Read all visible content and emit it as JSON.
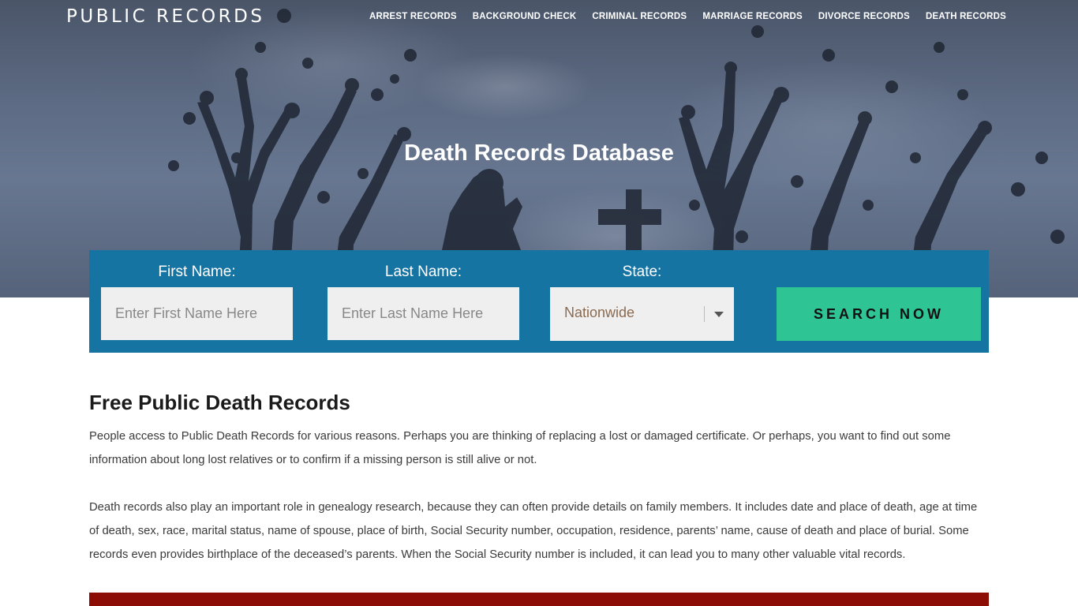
{
  "brand": {
    "name": "PUBLIC RECORDS"
  },
  "nav": {
    "items": [
      "ARREST RECORDS",
      "BACKGROUND CHECK",
      "CRIMINAL RECORDS",
      "MARRIAGE RECORDS",
      "DIVORCE RECORDS",
      "DEATH RECORDS"
    ]
  },
  "hero": {
    "title": "Death Records Database"
  },
  "search": {
    "first_name_label": "First Name:",
    "first_name_placeholder": "Enter First Name Here",
    "last_name_label": "Last Name:",
    "last_name_placeholder": "Enter Last Name Here",
    "state_label": "State:",
    "state_value": "Nationwide",
    "button_label": "SEARCH NOW"
  },
  "content": {
    "heading": "Free Public Death Records",
    "paragraphs": [
      "People access to Public Death Records for various reasons. Perhaps you are thinking of replacing a lost or damaged certificate. Or perhaps, you want to find out some information about long lost relatives or to confirm if a missing person is still alive or not.",
      "Death records also play an important role in genealogy research, because they can often provide details on family members. It includes date and place of death, age at time of death, sex, race, marital status, name of spouse, place of birth, Social Security number, occupation, residence, parents’ name, cause of death and place of burial. Some records even provides birthplace of the deceased’s parents. When the Social Security number is included, it can lead you to many other valuable vital records."
    ]
  },
  "colors": {
    "search_panel": "#1674a3",
    "search_button": "#2ec493",
    "footer_bar": "#8b0d05",
    "hero_sky": "#5d6b84"
  },
  "icons": {
    "state_dropdown": "chevron-down-icon"
  }
}
